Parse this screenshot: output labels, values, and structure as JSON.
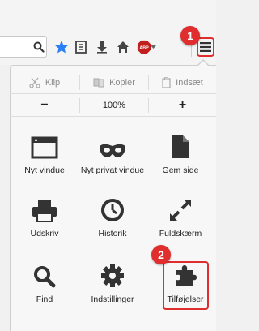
{
  "edit": {
    "cut": "Klip",
    "copy": "Kopier",
    "paste": "Indsæt"
  },
  "zoom": {
    "minus": "−",
    "level": "100%",
    "plus": "+"
  },
  "items": [
    {
      "label": "Nyt vindue",
      "icon": "window-icon"
    },
    {
      "label": "Nyt privat vindue",
      "icon": "mask-icon"
    },
    {
      "label": "Gem side",
      "icon": "document-icon"
    },
    {
      "label": "Udskriv",
      "icon": "printer-icon"
    },
    {
      "label": "Historik",
      "icon": "clock-icon"
    },
    {
      "label": "Fuldskærm",
      "icon": "fullscreen-icon"
    },
    {
      "label": "Find",
      "icon": "search-icon"
    },
    {
      "label": "Indstillinger",
      "icon": "gear-icon"
    },
    {
      "label": "Tilføjelser",
      "icon": "puzzle-icon"
    }
  ],
  "badges": {
    "first": "1",
    "second": "2"
  },
  "toolbar": {
    "abp_label": "ABP"
  },
  "colors": {
    "highlight": "#e02d2d",
    "star": "#2a7ff5",
    "abp": "#c21e1e"
  }
}
